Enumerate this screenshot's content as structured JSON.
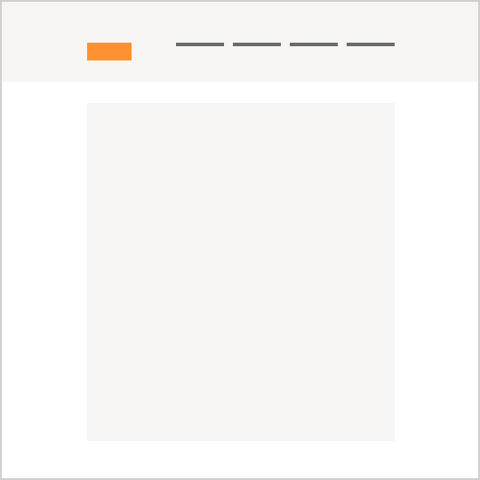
{
  "colors": {
    "frame_border": "#cfcfcf",
    "header_background": "#f6f5f3",
    "logo_accent": "#ff9130",
    "nav_line": "#6b6b69",
    "content_background": "#f6f5f3"
  },
  "header": {
    "nav": {
      "items": [
        {
          "name": "nav-item-1"
        },
        {
          "name": "nav-item-2"
        },
        {
          "name": "nav-item-3"
        },
        {
          "name": "nav-item-4"
        }
      ]
    }
  }
}
